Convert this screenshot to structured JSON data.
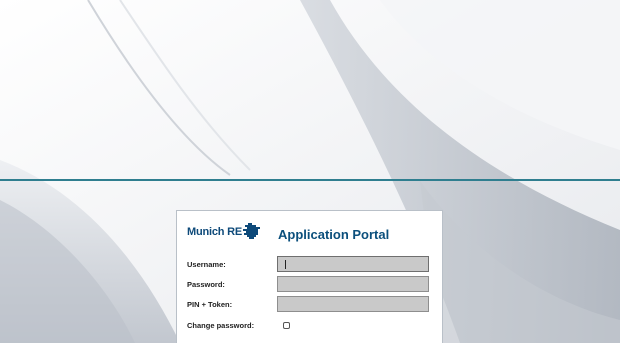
{
  "brand": {
    "name": "Munich RE",
    "color": "#0e4a7a"
  },
  "portal": {
    "title": "Application Portal"
  },
  "form": {
    "username_label": "Username:",
    "username_value": "",
    "password_label": "Password:",
    "password_value": "",
    "pin_token_label": "PIN + Token:",
    "pin_token_value": "",
    "change_password_label": "Change password:",
    "change_password_checked": false
  },
  "colors": {
    "divider": "#2f7e8f",
    "input_fill": "#c9c9c9",
    "title": "#0b4f7c"
  },
  "icons": {
    "brand_mark": "munich-re-logo-icon"
  }
}
